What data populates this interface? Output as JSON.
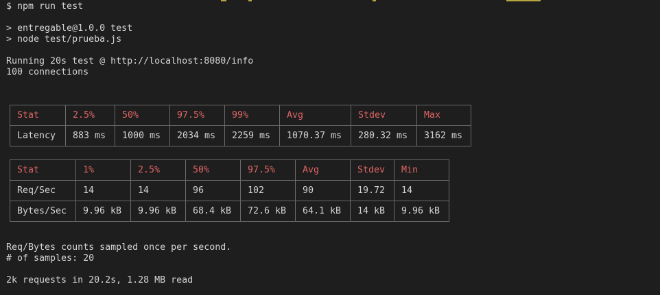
{
  "terminal": {
    "command_line": "$ npm run test",
    "script_line": "> entregable@1.0.0 test",
    "node_line": "> node test/prueba.js",
    "running_line": "Running 20s test @ http://localhost:8080/info",
    "connections_line": "100 connections",
    "latency_table": {
      "headers": [
        "Stat",
        "2.5%",
        "50%",
        "97.5%",
        "99%",
        "Avg",
        "Stdev",
        "Max"
      ],
      "rows": [
        [
          "Latency",
          "883 ms",
          "1000 ms",
          "2034 ms",
          "2259 ms",
          "1070.37 ms",
          "280.32 ms",
          "3162 ms"
        ]
      ]
    },
    "throughput_table": {
      "headers": [
        "Stat",
        "1%",
        "2.5%",
        "50%",
        "97.5%",
        "Avg",
        "Stdev",
        "Min"
      ],
      "rows": [
        [
          "Req/Sec",
          "14",
          "14",
          "96",
          "102",
          "90",
          "19.72",
          "14"
        ],
        [
          "Bytes/Sec",
          "9.96 kB",
          "9.96 kB",
          "68.4 kB",
          "72.6 kB",
          "64.1 kB",
          "14 kB",
          "9.96 kB"
        ]
      ]
    },
    "sampled_line": "Req/Bytes counts sampled once per second.",
    "samples_line": "# of samples: 20",
    "summary_line": "2k requests in 20.2s, 1.28 MB read"
  },
  "colors": {
    "background": "#1e1e1e",
    "text": "#d4d4d4",
    "header_text": "#e06464",
    "table_border": "#6b6b6b"
  }
}
